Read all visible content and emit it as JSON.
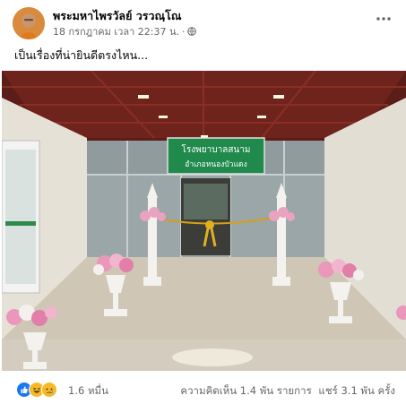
{
  "post": {
    "author": "พระมหาไพรวัลย์ วรวณฺโณ",
    "timestamp": "18 กรกฎาคม เวลา 22:37 น.",
    "audience_icon": "globe-icon",
    "caption": "เป็นเรื่องที่น่ายินดีตรงไหน..."
  },
  "photo": {
    "sign_line1": "โรงพยาบาลสนาม",
    "sign_line2": "อำเภอหนองบัวแดง"
  },
  "footer": {
    "reaction_icons": [
      "like-icon",
      "haha-icon",
      "sad-icon"
    ],
    "reaction_count": "1.6 หมื่น",
    "comments": "ความคิดเห็น 1.4 พัน รายการ",
    "shares": "แชร์ 3.1 พัน ครั้ง"
  },
  "colors": {
    "sign_green": "#1f8a4c",
    "like_blue": "#1877f2",
    "reaction_yellow": "#f7b928",
    "meta_gray": "#65676b"
  }
}
